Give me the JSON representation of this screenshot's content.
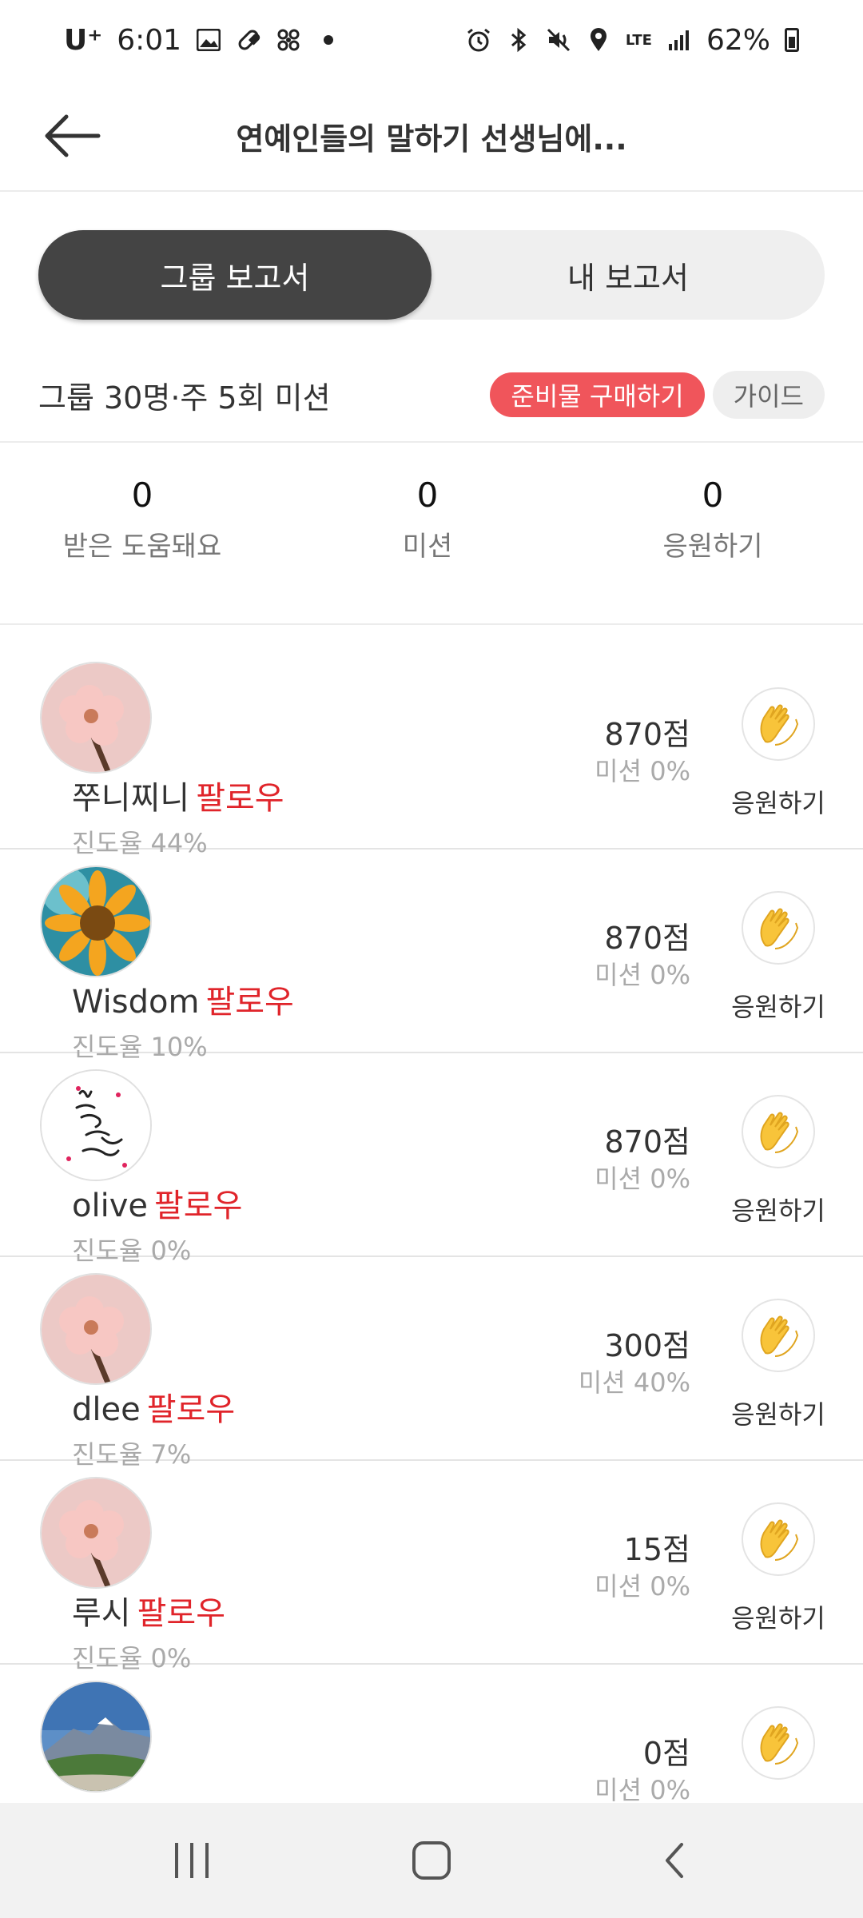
{
  "status_bar": {
    "carrier": "U⁺",
    "time": "6:01",
    "network": "LTE",
    "battery_percent": "62%"
  },
  "header": {
    "title": "연예인들의 말하기 선생님에..."
  },
  "tabs": [
    {
      "label": "그룹 보고서",
      "active": true
    },
    {
      "label": "내 보고서",
      "active": false
    }
  ],
  "info": {
    "text": "그룹 30명·주 5회 미션",
    "buy_label": "준비물 구매하기",
    "guide_label": "가이드"
  },
  "stats": [
    {
      "value": "0",
      "label": "받은 도움돼요"
    },
    {
      "value": "0",
      "label": "미션"
    },
    {
      "value": "0",
      "label": "응원하기"
    }
  ],
  "members": [
    {
      "name": "쭈니찌니",
      "follow": "팔로우",
      "progress": "진도율 44%",
      "score": "870점",
      "mission": "미션 0%",
      "cheer": "응원하기",
      "avatar": "plum-blossom"
    },
    {
      "name": "Wisdom",
      "follow": "팔로우",
      "progress": "진도율 10%",
      "score": "870점",
      "mission": "미션 0%",
      "cheer": "응원하기",
      "avatar": "sunflower"
    },
    {
      "name": "olive",
      "follow": "팔로우",
      "progress": "진도율 0%",
      "score": "870점",
      "mission": "미션 0%",
      "cheer": "응원하기",
      "avatar": "calligraphy"
    },
    {
      "name": "dlee",
      "follow": "팔로우",
      "progress": "진도율 7%",
      "score": "300점",
      "mission": "미션 40%",
      "cheer": "응원하기",
      "avatar": "plum-blossom"
    },
    {
      "name": "루시",
      "follow": "팔로우",
      "progress": "진도율 0%",
      "score": "15점",
      "mission": "미션 0%",
      "cheer": "응원하기",
      "avatar": "plum-blossom"
    },
    {
      "name": "",
      "follow": "",
      "progress": "",
      "score": "0점",
      "mission": "미션 0%",
      "cheer": "",
      "avatar": "mountain"
    }
  ],
  "colors": {
    "accent_red": "#e0242a",
    "buy_button": "#f0555b",
    "active_tab": "#444444"
  }
}
